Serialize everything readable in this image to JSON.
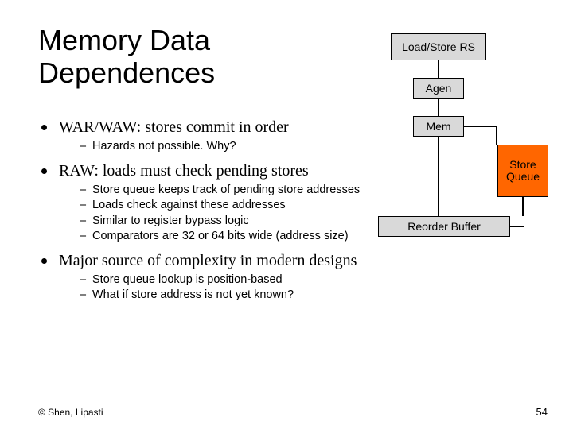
{
  "title": "Memory Data\nDependences",
  "bullets": [
    {
      "text": "WAR/WAW: stores commit in order",
      "subs": [
        "Hazards not possible.  Why?"
      ]
    },
    {
      "text": "RAW: loads must check pending stores",
      "subs": [
        "Store queue keeps track of pending store addresses",
        "Loads check against these addresses",
        "Similar to register bypass logic",
        "Comparators are 32 or 64 bits wide (address size)"
      ]
    },
    {
      "text": "Major source of complexity in modern designs",
      "subs": [
        "Store queue lookup is position-based",
        "What if store address is not yet known?"
      ]
    }
  ],
  "diagram": {
    "rs": "Load/Store RS",
    "agen": "Agen",
    "mem": "Mem",
    "store_queue": "Store\nQueue",
    "reorder": "Reorder Buffer"
  },
  "footer": "© Shen, Lipasti",
  "page_number": "54"
}
